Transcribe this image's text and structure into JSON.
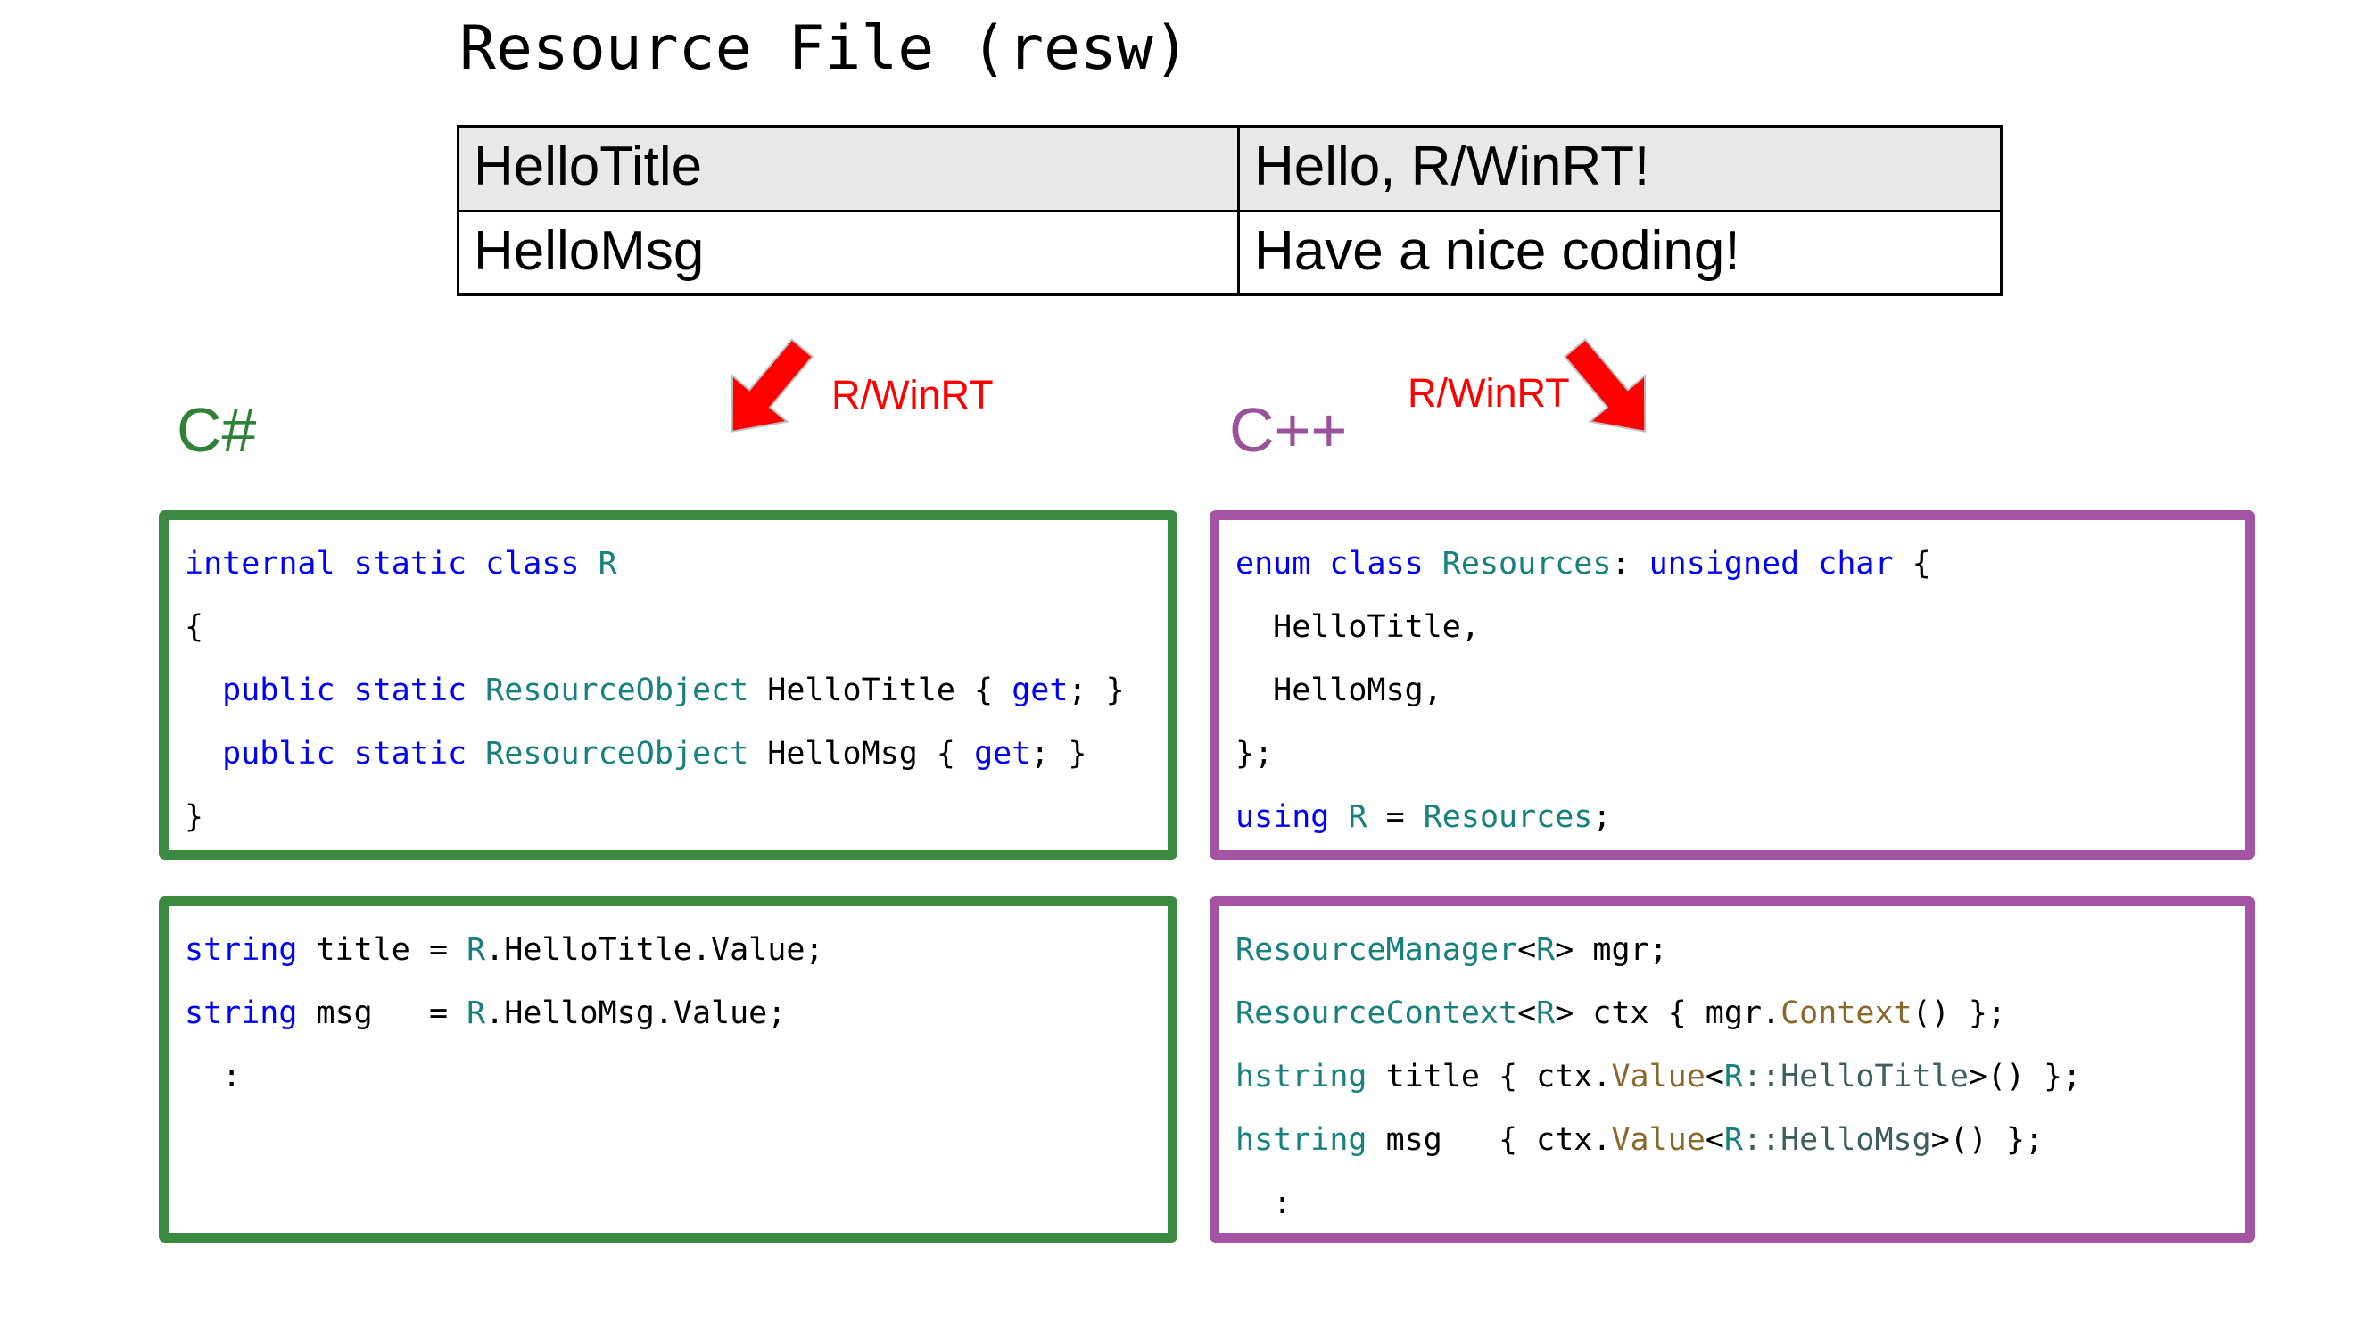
{
  "title": "Resource File (resw)",
  "resource_table": {
    "rows": [
      {
        "key": "HelloTitle",
        "value": "Hello, R/WinRT!",
        "shaded": true
      },
      {
        "key": "HelloMsg",
        "value": "Have a nice coding!",
        "shaded": false
      }
    ]
  },
  "arrows": {
    "left": {
      "label": "R/WinRT",
      "color": "#FF0000",
      "direction": "down-left"
    },
    "right": {
      "label": "R/WinRT",
      "color": "#FF0000",
      "direction": "down-right"
    }
  },
  "languages": {
    "csharp": {
      "label": "C#",
      "color": "#2F8238"
    },
    "cpp": {
      "label": "C++",
      "color": "#9B519C"
    }
  },
  "colors": {
    "keyword": "#0000FF",
    "type": "#18817E",
    "qualified": "#3E5F5F",
    "function": "#8A6A2C",
    "plain": "#000000",
    "green_border": "#3C8A3F",
    "purple_border": "#A354A2",
    "table_shade": "#e8e8e8",
    "arrow_red": "#FF0000"
  },
  "code_boxes": {
    "csharp_declaration": {
      "language": "C#",
      "border_color": "#3C8A3F",
      "lines": [
        [
          {
            "t": "internal static class ",
            "c": "kw"
          },
          {
            "t": "R",
            "c": "type"
          }
        ],
        [
          {
            "t": "{",
            "c": "plain"
          }
        ],
        [
          {
            "t": "  ",
            "c": "plain"
          },
          {
            "t": "public static ",
            "c": "kw"
          },
          {
            "t": "ResourceObject",
            "c": "type"
          },
          {
            "t": " HelloTitle { ",
            "c": "plain"
          },
          {
            "t": "get",
            "c": "kw"
          },
          {
            "t": "; }",
            "c": "plain"
          }
        ],
        [
          {
            "t": "  ",
            "c": "plain"
          },
          {
            "t": "public static ",
            "c": "kw"
          },
          {
            "t": "ResourceObject",
            "c": "type"
          },
          {
            "t": " HelloMsg { ",
            "c": "plain"
          },
          {
            "t": "get",
            "c": "kw"
          },
          {
            "t": "; }",
            "c": "plain"
          }
        ],
        [
          {
            "t": "}",
            "c": "plain"
          }
        ]
      ],
      "plain_text": "internal static class R\n{\n  public static ResourceObject HelloTitle { get; }\n  public static ResourceObject HelloMsg { get; }\n}"
    },
    "cpp_declaration": {
      "language": "C++",
      "border_color": "#A354A2",
      "lines": [
        [
          {
            "t": "enum class ",
            "c": "kw"
          },
          {
            "t": "Resources",
            "c": "type"
          },
          {
            "t": ": ",
            "c": "plain"
          },
          {
            "t": "unsigned char",
            "c": "kw"
          },
          {
            "t": " {",
            "c": "plain"
          }
        ],
        [
          {
            "t": "  HelloTitle,",
            "c": "plain"
          }
        ],
        [
          {
            "t": "  HelloMsg,",
            "c": "plain"
          }
        ],
        [
          {
            "t": "};",
            "c": "plain"
          }
        ],
        [
          {
            "t": "using",
            "c": "kw"
          },
          {
            "t": " ",
            "c": "plain"
          },
          {
            "t": "R",
            "c": "type"
          },
          {
            "t": " = ",
            "c": "plain"
          },
          {
            "t": "Resources",
            "c": "type"
          },
          {
            "t": ";",
            "c": "plain"
          }
        ]
      ],
      "plain_text": "enum class Resources: unsigned char {\n  HelloTitle,\n  HelloMsg,\n};\nusing R = Resources;"
    },
    "csharp_usage": {
      "language": "C#",
      "border_color": "#3C8A3F",
      "lines": [
        [
          {
            "t": "string",
            "c": "kw"
          },
          {
            "t": " title = ",
            "c": "plain"
          },
          {
            "t": "R",
            "c": "type"
          },
          {
            "t": ".HelloTitle.Value;",
            "c": "plain"
          }
        ],
        [
          {
            "t": "string",
            "c": "kw"
          },
          {
            "t": " msg   = ",
            "c": "plain"
          },
          {
            "t": "R",
            "c": "type"
          },
          {
            "t": ".HelloMsg.Value;",
            "c": "plain"
          }
        ],
        [
          {
            "t": "  :",
            "c": "plain"
          }
        ],
        [
          {
            "t": "",
            "c": "plain"
          }
        ],
        [
          {
            "t": "",
            "c": "plain"
          }
        ]
      ],
      "plain_text": "string title = R.HelloTitle.Value;\nstring msg   = R.HelloMsg.Value;\n  :"
    },
    "cpp_usage": {
      "language": "C++",
      "border_color": "#A354A2",
      "lines": [
        [
          {
            "t": "ResourceManager",
            "c": "type"
          },
          {
            "t": "<",
            "c": "plain"
          },
          {
            "t": "R",
            "c": "type"
          },
          {
            "t": "> mgr;",
            "c": "plain"
          }
        ],
        [
          {
            "t": "ResourceContext",
            "c": "type"
          },
          {
            "t": "<",
            "c": "plain"
          },
          {
            "t": "R",
            "c": "type"
          },
          {
            "t": "> ctx { mgr.",
            "c": "plain"
          },
          {
            "t": "Context",
            "c": "fn"
          },
          {
            "t": "() };",
            "c": "plain"
          }
        ],
        [
          {
            "t": "hstring",
            "c": "type"
          },
          {
            "t": " title { ctx.",
            "c": "plain"
          },
          {
            "t": "Value",
            "c": "fn"
          },
          {
            "t": "<",
            "c": "plain"
          },
          {
            "t": "R",
            "c": "type"
          },
          {
            "t": "::HelloTitle",
            "c": "qual"
          },
          {
            "t": ">() };",
            "c": "plain"
          }
        ],
        [
          {
            "t": "hstring",
            "c": "type"
          },
          {
            "t": " msg   { ctx.",
            "c": "plain"
          },
          {
            "t": "Value",
            "c": "fn"
          },
          {
            "t": "<",
            "c": "plain"
          },
          {
            "t": "R",
            "c": "type"
          },
          {
            "t": "::HelloMsg",
            "c": "qual"
          },
          {
            "t": ">() };",
            "c": "plain"
          }
        ],
        [
          {
            "t": "  :",
            "c": "plain"
          }
        ]
      ],
      "plain_text": "ResourceManager<R> mgr;\nResourceContext<R> ctx { mgr.Context() };\nhstring title { ctx.Value<R::HelloTitle>() };\nhstring msg   { ctx.Value<R::HelloMsg>() };\n  :"
    }
  }
}
